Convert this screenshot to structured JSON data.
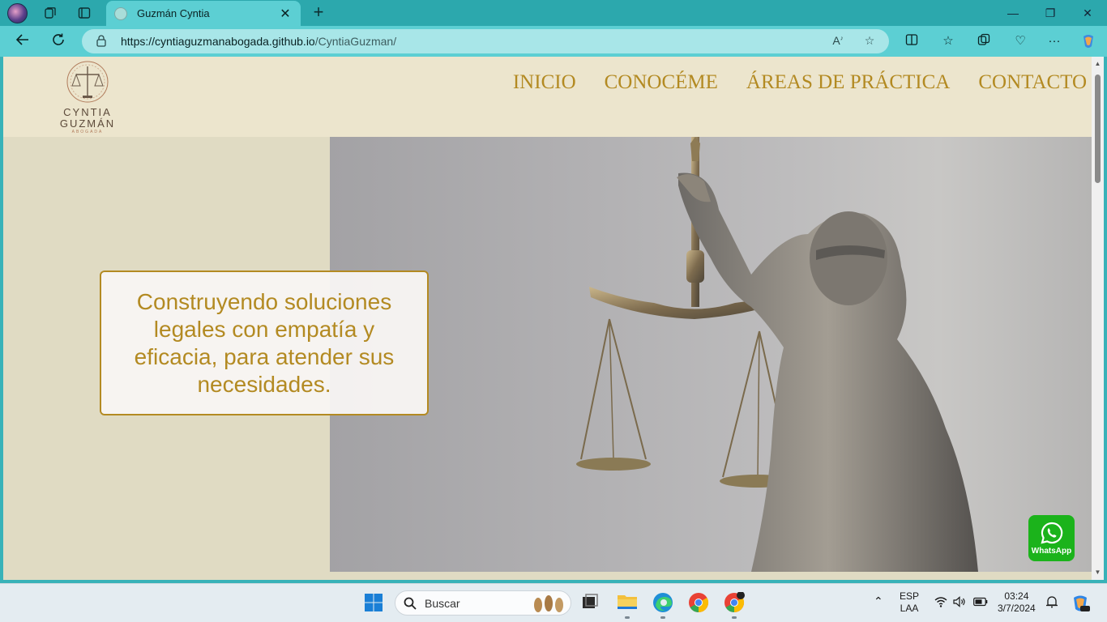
{
  "browser": {
    "tab_title": "Guzmán Cyntia",
    "url_host": "https://cyntiaguzmanabogada.github.io",
    "url_path": "/CyntiaGuzman/"
  },
  "site": {
    "logo_name_line1": "CYNTIA",
    "logo_name_line2": "GUZMÁN",
    "logo_subtitle": "ABOGADA",
    "nav": [
      "INICIO",
      "CONOCÉME",
      "ÁREAS DE PRÁCTICA",
      "CONTACTO"
    ],
    "tagline": "Construyendo soluciones legales con empatía y eficacia, para atender sus necesidades.",
    "whatsapp_label": "WhatsApp"
  },
  "taskbar": {
    "search_placeholder": "Buscar",
    "language_line1": "ESP",
    "language_line2": "LAA",
    "time": "03:24",
    "date": "3/7/2024"
  },
  "colors": {
    "accent_gold": "#b38a22",
    "header_bg": "#ece5cd",
    "browser_chrome": "#5ccfd3",
    "whatsapp_green": "#1bb31b"
  }
}
